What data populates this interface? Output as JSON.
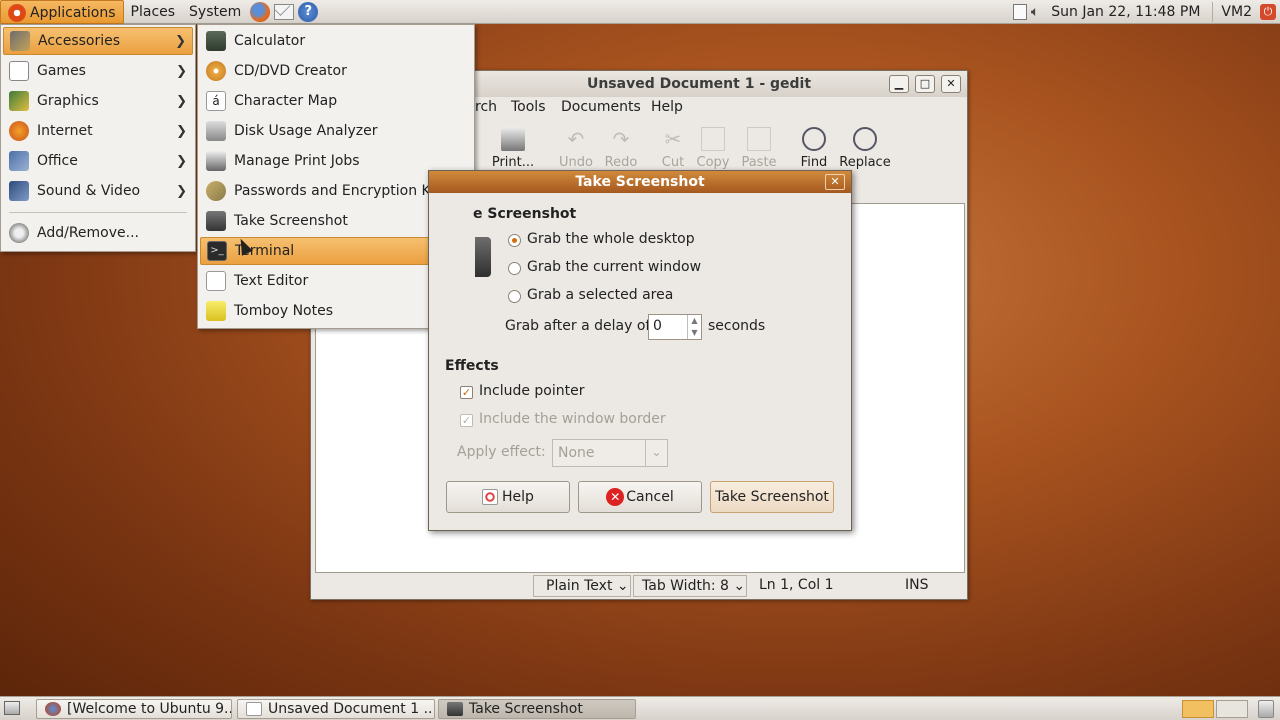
{
  "top_panel": {
    "menus": [
      "Applications",
      "Places",
      "System"
    ],
    "datetime": "Sun Jan 22, 11:48 PM",
    "user": "VM2"
  },
  "apps_menu": {
    "items": [
      {
        "label": "Accessories",
        "icon": "accessories-icon",
        "submenu": true
      },
      {
        "label": "Games",
        "icon": "games-icon",
        "submenu": true
      },
      {
        "label": "Graphics",
        "icon": "graphics-icon",
        "submenu": true
      },
      {
        "label": "Internet",
        "icon": "internet-icon",
        "submenu": true
      },
      {
        "label": "Office",
        "icon": "office-icon",
        "submenu": true
      },
      {
        "label": "Sound & Video",
        "icon": "sound-video-icon",
        "submenu": true
      }
    ],
    "add_remove": "Add/Remove..."
  },
  "accessories_menu": {
    "items": [
      "Calculator",
      "CD/DVD Creator",
      "Character Map",
      "Disk Usage Analyzer",
      "Manage Print Jobs",
      "Passwords and Encryption Keys",
      "Take Screenshot",
      "Terminal",
      "Text Editor",
      "Tomboy Notes"
    ],
    "highlighted": "Terminal"
  },
  "gedit": {
    "title": "Unsaved Document 1 - gedit",
    "menubar": [
      "rch",
      "Tools",
      "Documents",
      "Help"
    ],
    "toolbar": [
      "Print...",
      "Undo",
      "Redo",
      "Cut",
      "Copy",
      "Paste",
      "Find",
      "Replace"
    ],
    "status": {
      "lang": "Plain Text",
      "tab_width": "Tab Width:  8",
      "position": "Ln 1, Col 1",
      "mode": "INS"
    }
  },
  "dialog": {
    "title": "Take Screenshot",
    "section_title": "e Screenshot",
    "options": [
      "Grab the whole desktop",
      "Grab the current window",
      "Grab a selected area"
    ],
    "selected_option": 0,
    "delay_label": "Grab after a delay of",
    "delay_value": "0",
    "delay_unit": "seconds",
    "effects_title": "Effects",
    "include_pointer": "Include pointer",
    "include_border": "Include the window border",
    "apply_effect_label": "Apply effect:",
    "apply_effect_value": "None",
    "buttons": {
      "help": "Help",
      "cancel": "Cancel",
      "take": "Take Screenshot"
    }
  },
  "taskbar": {
    "tasks": [
      "[Welcome to Ubuntu 9...",
      "Unsaved Document 1 ...",
      "Take Screenshot"
    ]
  }
}
